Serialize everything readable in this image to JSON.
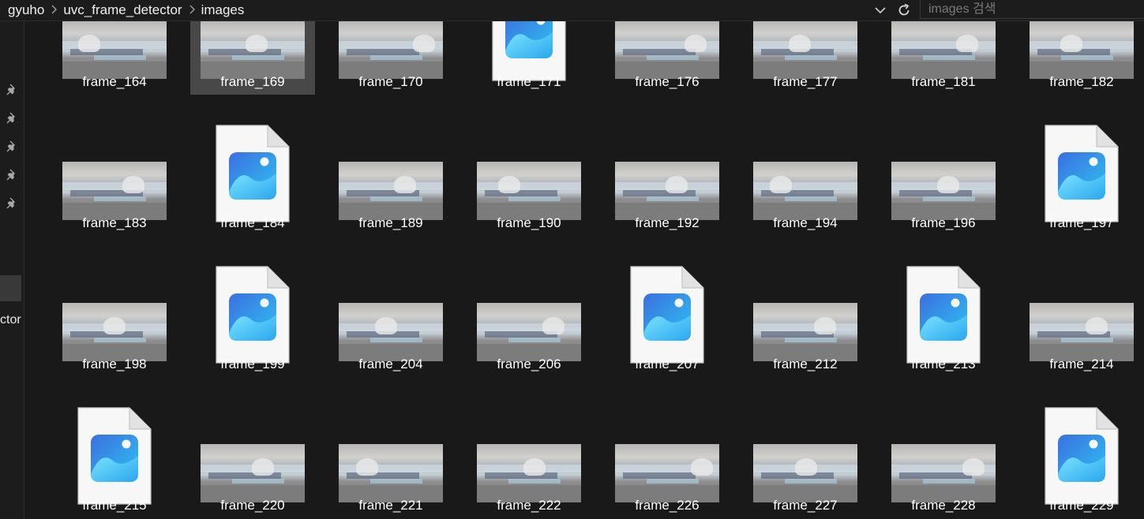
{
  "address": {
    "crumbs": [
      "gyuho",
      "uvc_frame_detector",
      "images"
    ],
    "search_placeholder": "images 검색"
  },
  "nav": {
    "partial_label": "ctor"
  },
  "files": [
    {
      "name": "frame_164",
      "kind": "photo"
    },
    {
      "name": "frame_169",
      "kind": "photo",
      "selected": true
    },
    {
      "name": "frame_170",
      "kind": "photo"
    },
    {
      "name": "frame_171",
      "kind": "icon"
    },
    {
      "name": "frame_176",
      "kind": "photo"
    },
    {
      "name": "frame_177",
      "kind": "photo"
    },
    {
      "name": "frame_181",
      "kind": "photo"
    },
    {
      "name": "frame_182",
      "kind": "photo"
    },
    {
      "name": "frame_183",
      "kind": "photo"
    },
    {
      "name": "frame_184",
      "kind": "icon"
    },
    {
      "name": "frame_189",
      "kind": "photo"
    },
    {
      "name": "frame_190",
      "kind": "photo"
    },
    {
      "name": "frame_192",
      "kind": "photo"
    },
    {
      "name": "frame_194",
      "kind": "photo"
    },
    {
      "name": "frame_196",
      "kind": "photo"
    },
    {
      "name": "frame_197",
      "kind": "icon"
    },
    {
      "name": "frame_198",
      "kind": "photo"
    },
    {
      "name": "frame_199",
      "kind": "icon"
    },
    {
      "name": "frame_204",
      "kind": "photo"
    },
    {
      "name": "frame_206",
      "kind": "photo"
    },
    {
      "name": "frame_207",
      "kind": "icon"
    },
    {
      "name": "frame_212",
      "kind": "photo"
    },
    {
      "name": "frame_213",
      "kind": "icon"
    },
    {
      "name": "frame_214",
      "kind": "photo"
    },
    {
      "name": "frame_215",
      "kind": "icon"
    },
    {
      "name": "frame_220",
      "kind": "photo"
    },
    {
      "name": "frame_221",
      "kind": "photo"
    },
    {
      "name": "frame_222",
      "kind": "photo"
    },
    {
      "name": "frame_226",
      "kind": "photo"
    },
    {
      "name": "frame_227",
      "kind": "photo"
    },
    {
      "name": "frame_228",
      "kind": "photo"
    },
    {
      "name": "frame_229",
      "kind": "icon"
    }
  ],
  "colors": {
    "background": "#191919",
    "selected_tile": "#484848",
    "icon_gradient_top": "#3b6fe0",
    "icon_gradient_bottom": "#2ec4f1"
  }
}
